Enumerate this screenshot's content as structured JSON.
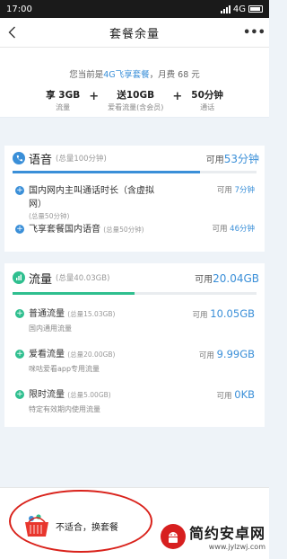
{
  "status": {
    "time": "17:00",
    "network": "4G"
  },
  "header": {
    "title": "套餐余量",
    "more": "•••"
  },
  "summary": {
    "plan_prefix": "您当前是",
    "plan_name": "4G飞享套餐",
    "plan_suffix": "，月费 68 元",
    "quotas": [
      {
        "big": "享 3GB",
        "small": "流量"
      },
      {
        "big": "送10GB",
        "small": "爱看流量(含会员)"
      },
      {
        "big": "50分钟",
        "small": "通话"
      }
    ],
    "plus": "+"
  },
  "voice": {
    "title": "语音",
    "total": "(总量100分钟)",
    "avail_label": "可用",
    "avail_value": "53分钟",
    "progress": 0.77,
    "items": [
      {
        "name": "国内网内主叫通话时长（含虚拟网）",
        "sub": "(总量50分钟)",
        "avail_label": "可用",
        "avail_value": "7分钟"
      },
      {
        "name": "飞享套餐国内语音",
        "sub": "(总量50分钟)",
        "avail_label": "可用",
        "avail_value": "46分钟"
      }
    ]
  },
  "data": {
    "title": "流量",
    "total": "(总量40.03GB)",
    "avail_label": "可用",
    "avail_value": "20.04GB",
    "progress": 0.5,
    "items": [
      {
        "name": "普通流量",
        "sub": "(总量15.03GB)",
        "desc": "国内通用流量",
        "avail_label": "可用",
        "avail_value": "10.05GB"
      },
      {
        "name": "爱看流量",
        "sub": "(总量20.00GB)",
        "desc": "咪咕爱看app专用流量",
        "avail_label": "可用",
        "avail_value": "9.99GB"
      },
      {
        "name": "限时流量",
        "sub": "(总量5.00GB)",
        "desc": "特定有效期内使用流量",
        "avail_label": "可用",
        "avail_value": "0KB"
      }
    ]
  },
  "bottom": {
    "change_label": "不适合，换套餐"
  },
  "watermark": {
    "title": "简约安卓网",
    "url": "www.jylzwj.com"
  },
  "colors": {
    "accent": "#3a8fd8",
    "green": "#2fbf8f",
    "highlight_circle": "#d9221b",
    "brand_red": "#d71f1f"
  }
}
